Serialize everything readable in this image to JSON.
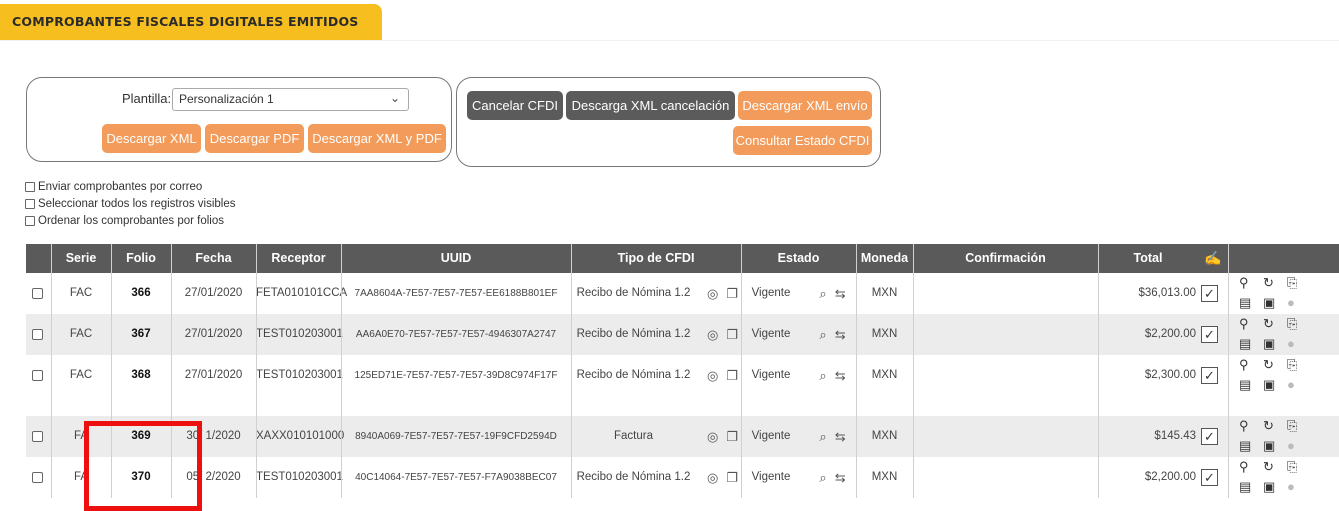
{
  "header": {
    "title": "COMPROBANTES FISCALES DIGITALES EMITIDOS"
  },
  "template_panel": {
    "label": "Plantilla:",
    "selected": "Personalización 1",
    "buttons": [
      "Descargar XML",
      "Descargar PDF",
      "Descargar XML y PDF"
    ]
  },
  "cancel_panel": {
    "buttons": [
      "Cancelar CFDI",
      "Descarga XML cancelación",
      "Descargar XML envío",
      "Consultar Estado CFDI"
    ]
  },
  "options": [
    "Enviar comprobantes por correo",
    "Seleccionar todos los registros visibles",
    "Ordenar los comprobantes por folios"
  ],
  "table": {
    "headers": [
      "Serie",
      "Folio",
      "Fecha",
      "Receptor",
      "UUID",
      "Tipo de CFDI",
      "Estado",
      "Moneda",
      "Confirmación",
      "Total"
    ],
    "rows": [
      {
        "serie": "FAC",
        "folio": "366",
        "fecha": "27/01/2020",
        "receptor": "FETA010101CCA",
        "uuid": "7AA8604A-7E57-7E57-7E57-EE6188B801EF",
        "tipo": "Recibo de Nómina 1.2",
        "estado": "Vigente",
        "moneda": "MXN",
        "confirmacion": "",
        "total": "$36,013.00"
      },
      {
        "serie": "FAC",
        "folio": "367",
        "fecha": "27/01/2020",
        "receptor": "TEST010203001",
        "uuid": "AA6A0E70-7E57-7E57-7E57-4946307A2747",
        "tipo": "Recibo de Nómina 1.2",
        "estado": "Vigente",
        "moneda": "MXN",
        "confirmacion": "",
        "total": "$2,200.00"
      },
      {
        "serie": "FAC",
        "folio": "368",
        "fecha": "27/01/2020",
        "receptor": "TEST010203001",
        "uuid": "125ED71E-7E57-7E57-7E57-39D8C974F17F",
        "tipo": "Recibo de Nómina 1.2",
        "estado": "Vigente",
        "moneda": "MXN",
        "confirmacion": "",
        "total": "$2,300.00"
      },
      {
        "serie": "FA",
        "folio": "369",
        "fecha": "30/ 1/2020",
        "receptor": "XAXX010101000",
        "uuid": "8940A069-7E57-7E57-7E57-19F9CFD2594D",
        "tipo": "Factura",
        "estado": "Vigente",
        "moneda": "MXN",
        "confirmacion": "",
        "total": "$145.43"
      },
      {
        "serie": "FA",
        "folio": "370",
        "fecha": "05/ 2/2020",
        "receptor": "TEST010203001",
        "uuid": "40C14064-7E57-7E57-7E57-F7A9038BEC07",
        "tipo": "Recibo de Nómina 1.2",
        "estado": "Vigente",
        "moneda": "MXN",
        "confirmacion": "",
        "total": "$2,200.00"
      }
    ]
  },
  "colors": {
    "accent": "#f6bf1f",
    "orange_button": "#f29b5a",
    "dark_button": "#5b5b5b",
    "header": "#5a5a5a",
    "highlight": "#ee0f0f"
  }
}
